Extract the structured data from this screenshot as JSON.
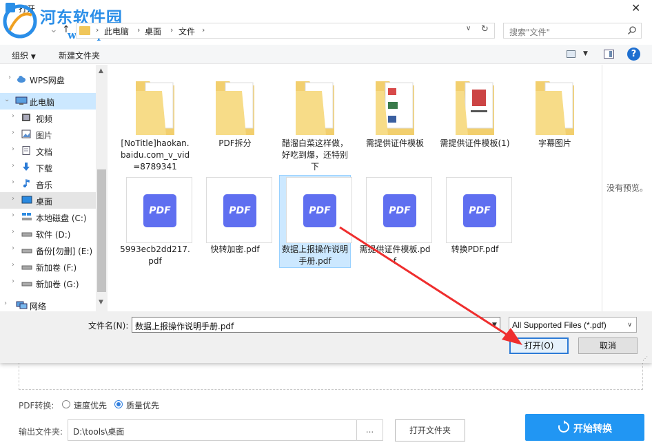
{
  "dialog": {
    "title": "打开",
    "watermark": {
      "site": "河东软件园",
      "url": "www.pc0359.cn"
    },
    "address": {
      "crumbs": [
        "此电脑",
        "桌面",
        "文件"
      ]
    },
    "search": {
      "placeholder": "搜索\"文件\""
    },
    "toolbar": {
      "organize": "组织",
      "new_folder": "新建文件夹"
    },
    "sidebar": [
      {
        "label": "WPS网盘",
        "icon": "cloud-icon"
      },
      {
        "label": "此电脑",
        "icon": "computer-icon"
      },
      {
        "label": "视频",
        "icon": "video-icon"
      },
      {
        "label": "图片",
        "icon": "picture-icon"
      },
      {
        "label": "文档",
        "icon": "document-icon"
      },
      {
        "label": "下载",
        "icon": "download-icon"
      },
      {
        "label": "音乐",
        "icon": "music-icon"
      },
      {
        "label": "桌面",
        "icon": "desktop-icon"
      },
      {
        "label": "本地磁盘 (C:)",
        "icon": "drive-icon"
      },
      {
        "label": "软件 (D:)",
        "icon": "drive-icon"
      },
      {
        "label": "备份[勿删] (E:)",
        "icon": "drive-icon"
      },
      {
        "label": "新加卷 (F:)",
        "icon": "drive-icon"
      },
      {
        "label": "新加卷 (G:)",
        "icon": "drive-icon"
      },
      {
        "label": "网络",
        "icon": "network-icon"
      }
    ],
    "files": [
      {
        "name": "[NoTitle]haokan.baidu.com_v_vid=8789341",
        "type": "folder"
      },
      {
        "name": "PDF拆分",
        "type": "folder"
      },
      {
        "name": "醋溜白菜这样做，好吃到爆，还特别下",
        "type": "folder"
      },
      {
        "name": "需提供证件模板",
        "type": "folder"
      },
      {
        "name": "需提供证件模板(1)",
        "type": "folder"
      },
      {
        "name": "字幕图片",
        "type": "folder"
      },
      {
        "name": "5993ecb2dd217.pdf",
        "type": "pdf"
      },
      {
        "name": "快转加密.pdf",
        "type": "pdf"
      },
      {
        "name": "数据上报操作说明手册.pdf",
        "type": "pdf",
        "selected": true
      },
      {
        "name": "需提供证件模板.pdf",
        "type": "pdf"
      },
      {
        "name": "转换PDF.pdf",
        "type": "pdf"
      }
    ],
    "pdf_badge": "PDF",
    "preview_text": "没有预览。",
    "filename_label": "文件名(N):",
    "filename_value": "数据上报操作说明手册.pdf",
    "filter": "All Supported Files (*.pdf)",
    "open_button": "打开(O)",
    "cancel_button": "取消"
  },
  "app": {
    "pdf_convert_label": "PDF转换:",
    "options": [
      "速度优先",
      "质量优先"
    ],
    "selected_option": "质量优先",
    "output_label": "输出文件夹:",
    "output_path": "D:\\tools\\桌面",
    "browse": "...",
    "open_folder": "打开文件夹",
    "start": "开始转换"
  },
  "colors": {
    "accent": "#2196f3",
    "annotation_arrow": "#ef2e2e",
    "pdf_badge": "#5f6ff0",
    "selection": "#cce8ff"
  }
}
